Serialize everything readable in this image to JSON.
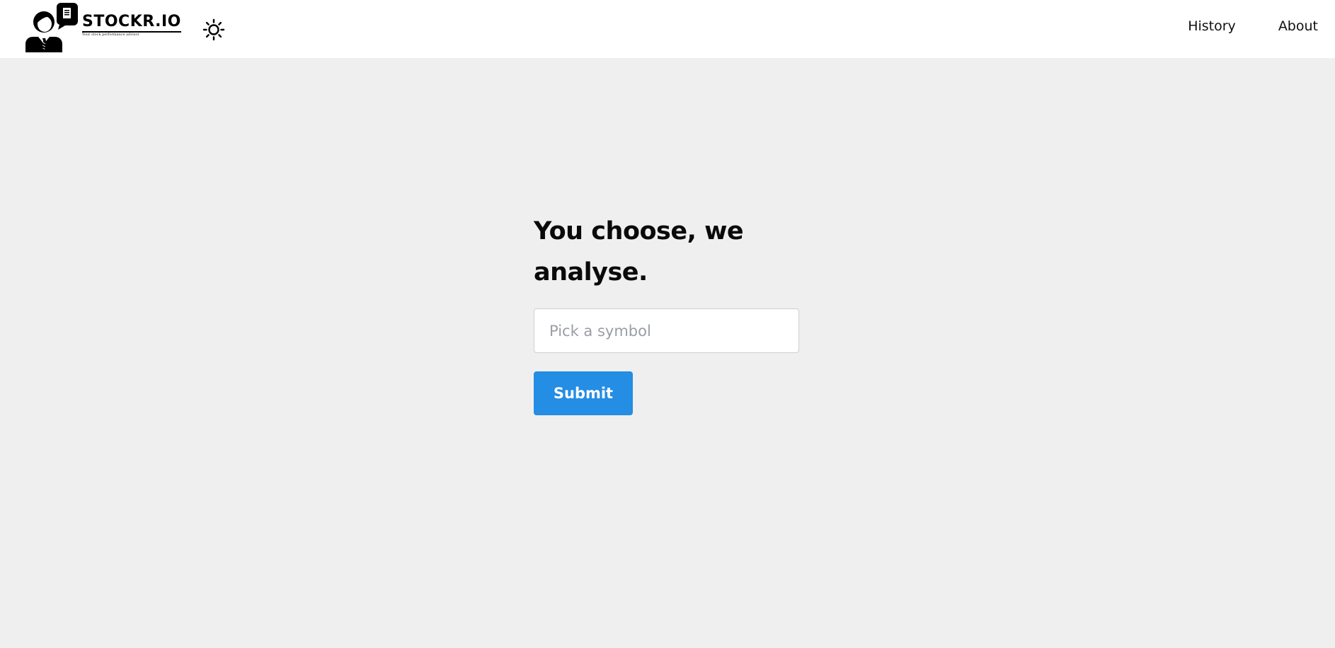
{
  "brand": {
    "name": "STOCKR.IO",
    "tagline": "Your stock performance advisor",
    "logo_icon": "advisor-logo-icon"
  },
  "header": {
    "theme_toggle_icon": "sun-icon"
  },
  "nav": {
    "items": [
      {
        "label": "History"
      },
      {
        "label": "About"
      }
    ]
  },
  "main": {
    "headline": "You choose, we analyse.",
    "search": {
      "placeholder": "Pick a symbol",
      "value": ""
    },
    "submit_label": "Submit"
  },
  "colors": {
    "background": "#efefef",
    "header": "#ffffff",
    "accent": "#248de4"
  }
}
